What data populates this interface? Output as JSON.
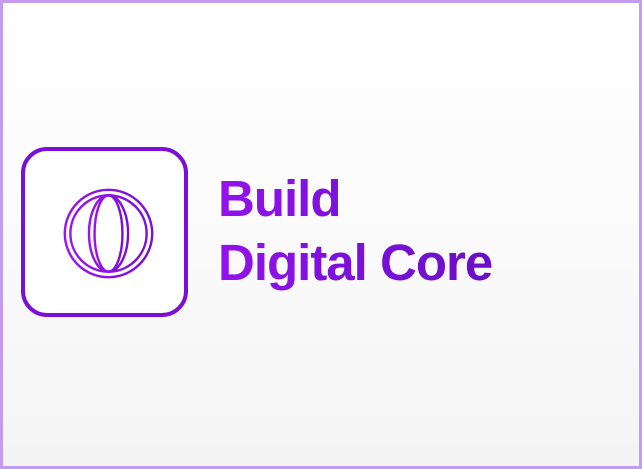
{
  "card": {
    "icon": "globe-icon",
    "title_line_1": "Build",
    "title_line_2": "Digital Core"
  },
  "colors": {
    "accent": "#7a10d6",
    "text_start": "#9412ec",
    "text_end": "#6a0fc6",
    "border": "#c39cf0"
  }
}
